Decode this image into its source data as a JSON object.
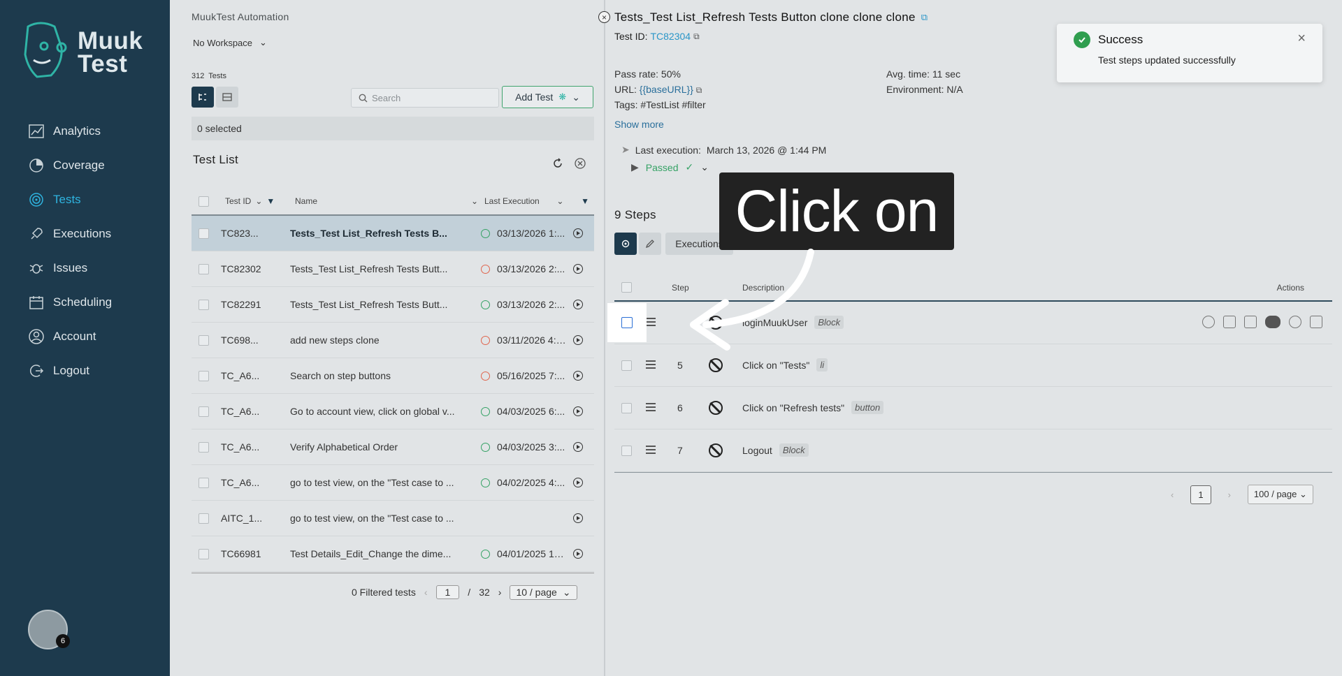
{
  "app": {
    "title": "MuukTest Automation",
    "logo_text": "Muuk\nTest",
    "workspace": "No Workspace"
  },
  "sidebar": {
    "items": [
      {
        "label": "Analytics",
        "icon": "analytics-icon",
        "active": false
      },
      {
        "label": "Coverage",
        "icon": "coverage-icon",
        "active": false
      },
      {
        "label": "Tests",
        "icon": "tests-icon",
        "active": true
      },
      {
        "label": "Executions",
        "icon": "rocket-icon",
        "active": false
      },
      {
        "label": "Issues",
        "icon": "bug-icon",
        "active": false
      },
      {
        "label": "Scheduling",
        "icon": "calendar-icon",
        "active": false
      },
      {
        "label": "Account",
        "icon": "user-icon",
        "active": false
      },
      {
        "label": "Logout",
        "icon": "logout-icon",
        "active": false
      }
    ],
    "avatar_badge": "6"
  },
  "list": {
    "count_number": "312",
    "count_label": "Tests",
    "search_placeholder": "Search",
    "add_test_label": "Add Test",
    "selected_text": "0 selected",
    "title": "Test List",
    "columns": [
      "Test ID",
      "Name",
      "Last Execution"
    ],
    "rows": [
      {
        "id": "TC823...",
        "name": "Tests_Test List_Refresh Tests B...",
        "status": "ok",
        "date": "03/13/2026 1:...",
        "selected": true
      },
      {
        "id": "TC82302",
        "name": "Tests_Test List_Refresh Tests Butt...",
        "status": "err",
        "date": "03/13/2026 2:...",
        "selected": false
      },
      {
        "id": "TC82291",
        "name": "Tests_Test List_Refresh Tests Butt...",
        "status": "ok",
        "date": "03/13/2026 2:...",
        "selected": false
      },
      {
        "id": "TC698...",
        "name": "add new steps clone",
        "status": "err",
        "date": "03/11/2026 4:1...",
        "selected": false
      },
      {
        "id": "TC_A6...",
        "name": "Search on step buttons",
        "status": "err",
        "date": "05/16/2025 7:...",
        "selected": false
      },
      {
        "id": "TC_A6...",
        "name": "Go to account view, click on global v...",
        "status": "ok",
        "date": "04/03/2025 6:...",
        "selected": false
      },
      {
        "id": "TC_A6...",
        "name": "Verify Alphabetical Order",
        "status": "ok",
        "date": "04/03/2025 3:...",
        "selected": false
      },
      {
        "id": "TC_A6...",
        "name": "go to test view, on the \"Test case to ...",
        "status": "ok",
        "date": "04/02/2025 4:...",
        "selected": false
      },
      {
        "id": "AITC_1...",
        "name": "go to test view, on the \"Test case to ...",
        "status": "",
        "date": "",
        "selected": false
      },
      {
        "id": "TC66981",
        "name": "Test Details_Edit_Change the dime...",
        "status": "ok",
        "date": "04/01/2025 12...",
        "selected": false
      }
    ],
    "footer": {
      "filtered": "0 Filtered tests",
      "page": "1",
      "sep": "/",
      "total_pages": "32",
      "page_size": "10 / page"
    }
  },
  "detail": {
    "title": "Tests_Test List_Refresh Tests Button clone clone clone",
    "test_id_label": "Test ID:",
    "test_id": "TC82304",
    "pass_rate": "Pass rate: 50%",
    "url_label": "URL:",
    "url_value": "{{baseURL}}",
    "tags": "Tags: #TestList #filter",
    "avg_time": "Avg. time: 11 sec",
    "environment": "Environment: N/A",
    "show_more": "Show more",
    "last_exec_label": "Last execution:",
    "last_exec_value": "March 13, 2026 @ 1:44 PM",
    "exec_status": "Passed",
    "steps_title": "9 Steps",
    "executions_btn": "Executions",
    "steps_columns": {
      "step": "Step",
      "description": "Description",
      "actions": "Actions"
    },
    "steps": [
      {
        "num": "",
        "desc": "loginMuukUser",
        "tag": "Block",
        "actions": true
      },
      {
        "num": "5",
        "desc": "Click on  \"Tests\"",
        "tag": "li",
        "actions": false
      },
      {
        "num": "6",
        "desc": "Click on  \"Refresh tests\"",
        "tag": "button",
        "actions": false
      },
      {
        "num": "7",
        "desc": "Logout",
        "tag": "Block",
        "actions": false
      }
    ],
    "pager": {
      "page": "1",
      "page_size": "100 / page"
    }
  },
  "overlay": {
    "callout_text": "Click on"
  },
  "toast": {
    "title": "Success",
    "message": "Test steps updated successfully"
  },
  "colors": {
    "sidebar_bg": "#1d3a4d",
    "accent": "#2fb4e0",
    "success": "#35a265",
    "error": "#e0654d"
  }
}
